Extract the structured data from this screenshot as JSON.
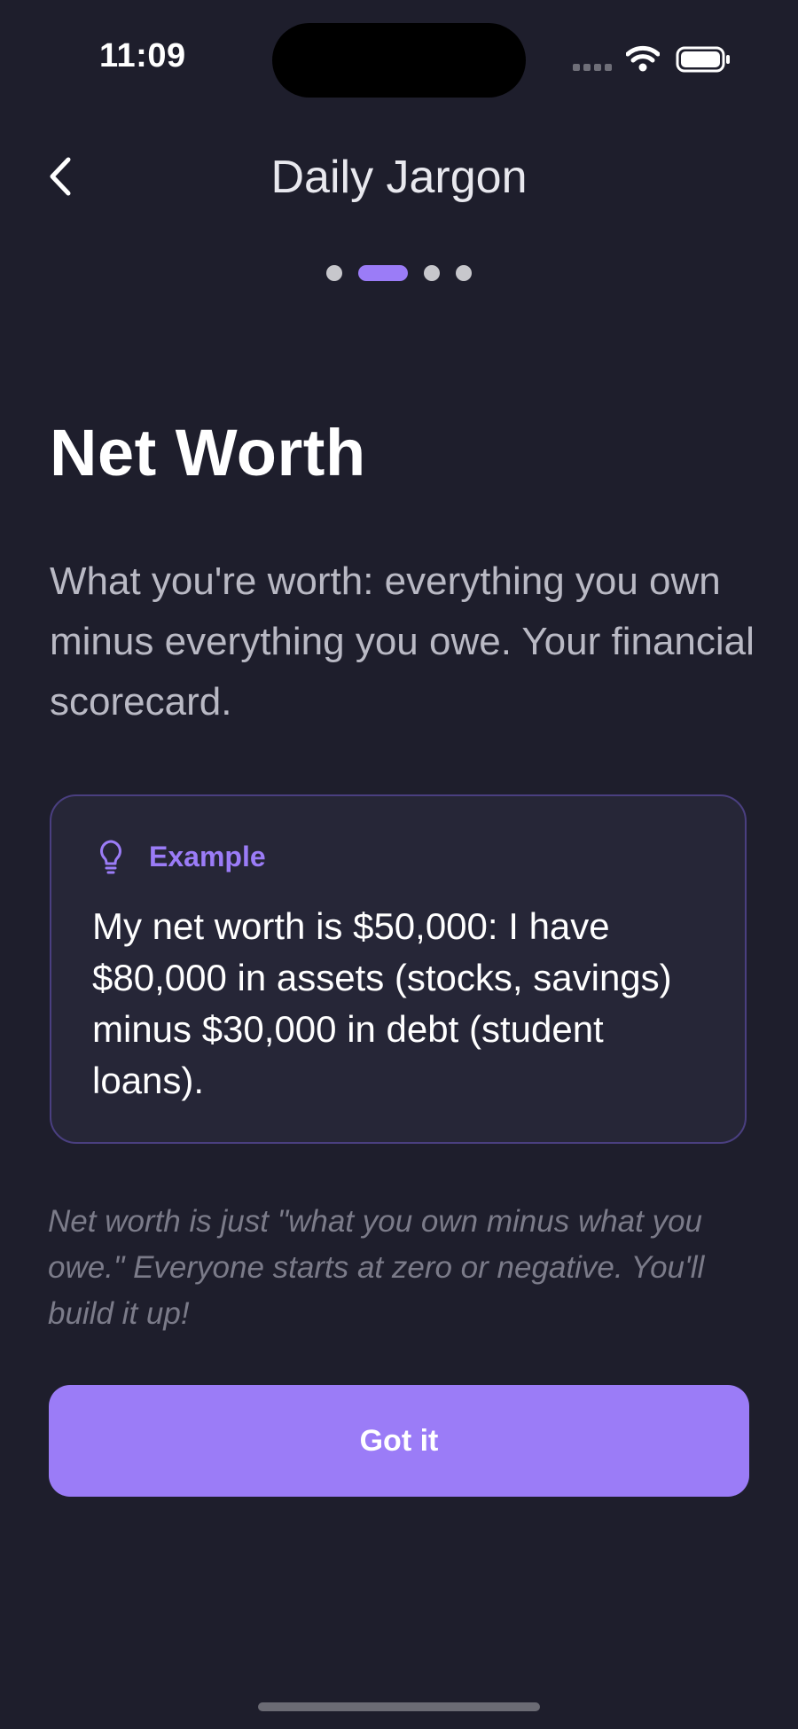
{
  "status_bar": {
    "time": "11:09"
  },
  "header": {
    "title": "Daily Jargon",
    "back_icon": "chevron-left-icon"
  },
  "pagination": {
    "total": 4,
    "current": 2
  },
  "term": {
    "title": "Net Worth",
    "definition": "What you're worth: everything you own minus everything you owe. Your financial scorecard."
  },
  "example": {
    "icon": "lightbulb-icon",
    "label": "Example",
    "text": "My net worth is $50,000: I have $80,000 in assets (stocks, savings) minus $30,000 in debt (student loans)."
  },
  "tip": "Net worth is just \"what you own minus what you owe.\" Everyone starts at zero or negative. You'll build it up!",
  "actions": {
    "primary_label": "Got it"
  },
  "colors": {
    "background": "#1e1e2c",
    "accent": "#9b7cf7",
    "card_background": "#262637",
    "card_border": "#4a3f80",
    "muted_text": "#7b7b89"
  }
}
